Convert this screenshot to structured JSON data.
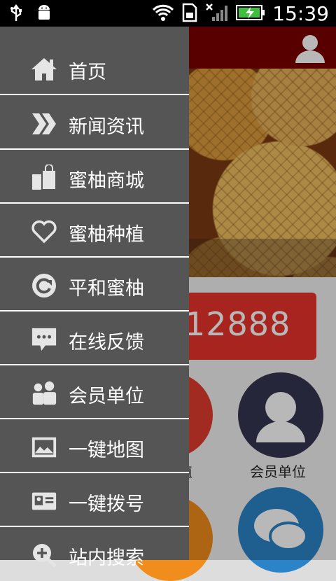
{
  "status_bar": {
    "time": "15:39"
  },
  "background": {
    "phone_number": "12888",
    "circle_labels": [
      "植",
      "会员单位"
    ]
  },
  "drawer": {
    "items": [
      {
        "label": "首页",
        "icon": "home-icon"
      },
      {
        "label": "新闻资讯",
        "icon": "double-chevron-icon"
      },
      {
        "label": "蜜柚商城",
        "icon": "shopping-bags-icon"
      },
      {
        "label": "蜜柚种植",
        "icon": "heart-icon"
      },
      {
        "label": "平和蜜柚",
        "icon": "refresh-icon"
      },
      {
        "label": "在线反馈",
        "icon": "chat-icon"
      },
      {
        "label": "会员单位",
        "icon": "members-icon"
      },
      {
        "label": "一键地图",
        "icon": "map-image-icon"
      },
      {
        "label": "一键拨号",
        "icon": "id-card-icon"
      },
      {
        "label": "站内搜索",
        "icon": "search-plus-icon"
      }
    ]
  },
  "colors": {
    "drawer_bg": "#555555",
    "topbar": "#7a0000",
    "accent_red": "#e8332b"
  }
}
